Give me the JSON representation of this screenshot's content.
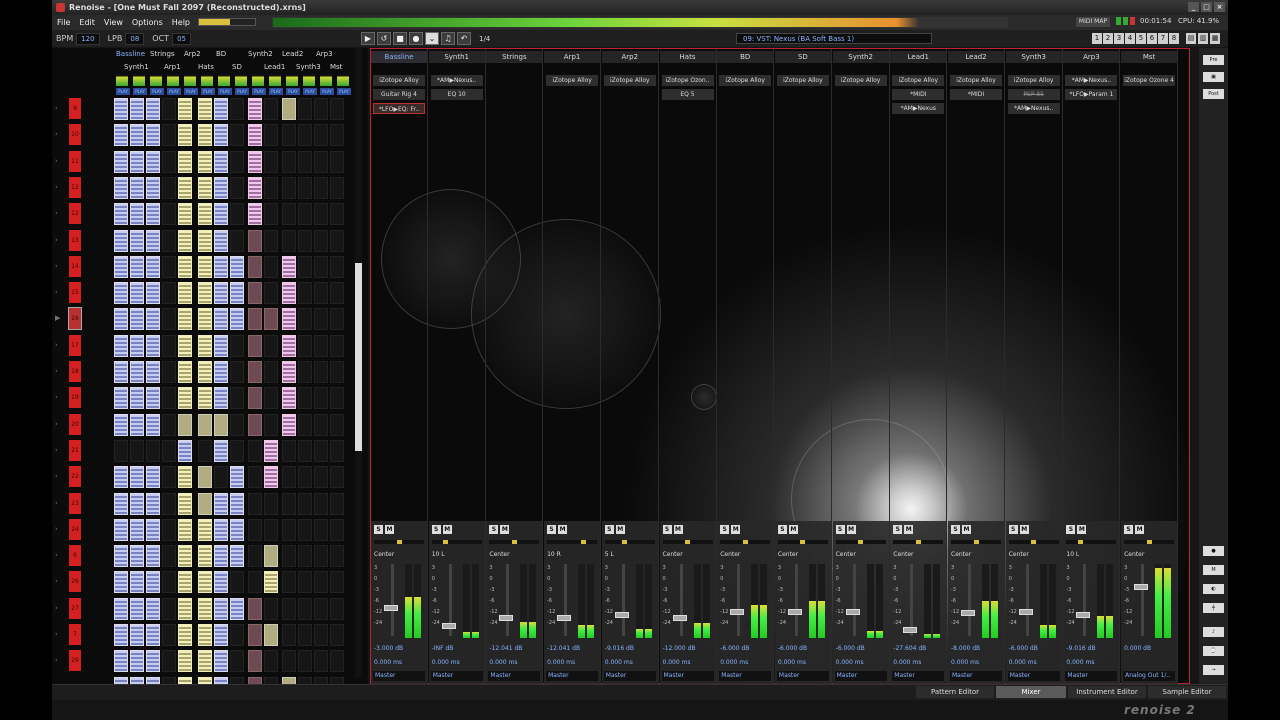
{
  "window": {
    "title": "Renoise - [One Must Fall 2097 (Reconstructed).xrns]"
  },
  "menu": [
    "File",
    "Edit",
    "View",
    "Options",
    "Help"
  ],
  "status": {
    "midi_map": "MIDI MAP",
    "time": "00:01:54",
    "cpu": "CPU: 41.9%"
  },
  "toolbar": {
    "bpm_label": "BPM",
    "bpm": "120",
    "lpb_label": "LPB",
    "lpb": "08",
    "oct_label": "OCT",
    "oct": "05",
    "line_spacing": "1/4"
  },
  "instrument": {
    "selected": "09: VST: Nexus (BA Soft Bass 1)"
  },
  "track_numbers": [
    "1",
    "2",
    "3",
    "4",
    "5",
    "6",
    "7",
    "8"
  ],
  "pattern_matrix": {
    "headers_top": [
      "Bassline",
      "Strings",
      "Arp2",
      "BD",
      "Synth2",
      "Lead2",
      "Arp3"
    ],
    "headers_bottom": [
      "Synth1",
      "Arp1",
      "Hats",
      "SD",
      "Lead1",
      "Synth3",
      "Mst"
    ],
    "play_label": "PLAY",
    "sequence": [
      "9",
      "10",
      "11",
      "12",
      "12",
      "13",
      "14",
      "15",
      "16",
      "17",
      "18",
      "19",
      "20",
      "21",
      "22",
      "23",
      "24",
      "6",
      "26",
      "27",
      "7",
      "29"
    ]
  },
  "mixer": {
    "tracks": [
      {
        "name": "Bassline",
        "fx": [
          "iZotope Alloy",
          "Guitar Rig 4",
          "*LFO▶EQ: Fr.."
        ],
        "pan": "Center",
        "vol": "-3.000 dB",
        "delay": "0.000 ms",
        "route": "Master"
      },
      {
        "name": "Synth1",
        "fx": [
          "*AM▶Nexus..",
          "EQ 10"
        ],
        "pan": "10 L",
        "vol": "-INF dB",
        "delay": "0.000 ms",
        "route": "Master"
      },
      {
        "name": "Strings",
        "fx": [],
        "pan": "Center",
        "vol": "-12.041 dB",
        "delay": "0.000 ms",
        "route": "Master"
      },
      {
        "name": "Arp1",
        "fx": [
          "iZotope Alloy"
        ],
        "pan": "10 R",
        "vol": "-12.041 dB",
        "delay": "0.000 ms",
        "route": "Master"
      },
      {
        "name": "Arp2",
        "fx": [
          "iZotope Alloy"
        ],
        "pan": "5 L",
        "vol": "-9.016 dB",
        "delay": "0.000 ms",
        "route": "Master"
      },
      {
        "name": "Hats",
        "fx": [
          "iZotope Ozon..",
          "EQ 5"
        ],
        "pan": "Center",
        "vol": "-12.000 dB",
        "delay": "0.000 ms",
        "route": "Master"
      },
      {
        "name": "BD",
        "fx": [
          "iZotope Alloy"
        ],
        "pan": "Center",
        "vol": "-6.000 dB",
        "delay": "0.000 ms",
        "route": "Master"
      },
      {
        "name": "SD",
        "fx": [
          "iZotope Alloy"
        ],
        "pan": "Center",
        "vol": "-6.000 dB",
        "delay": "0.000 ms",
        "route": "Master"
      },
      {
        "name": "Synth2",
        "fx": [
          "iZotope Alloy"
        ],
        "pan": "Center",
        "vol": "-6.000 dB",
        "delay": "0.000 ms",
        "route": "Master"
      },
      {
        "name": "Lead1",
        "fx": [
          "iZotope Alloy",
          "*MIDI",
          "*AM▶Nexus"
        ],
        "pan": "Center",
        "vol": "-27.604 dB",
        "delay": "0.000 ms",
        "route": "Master"
      },
      {
        "name": "Lead2",
        "fx": [
          "iZotope Alloy",
          "*MIDI"
        ],
        "pan": "Center",
        "vol": "-8.000 dB",
        "delay": "0.000 ms",
        "route": "Master"
      },
      {
        "name": "Synth3",
        "fx": [
          "iZotope Alloy",
          "PSP 85",
          "*AM▶Nexus.."
        ],
        "pan": "Center",
        "vol": "-6.000 dB",
        "delay": "0.000 ms",
        "route": "Master"
      },
      {
        "name": "Arp3",
        "fx": [
          "*AM▶Nexus..",
          "*LFO▶Param 1"
        ],
        "pan": "10 L",
        "vol": "-9.016 dB",
        "delay": "0.000 ms",
        "route": "Master"
      },
      {
        "name": "Mst",
        "fx": [
          "iZotope Ozone 4"
        ],
        "pan": "Center",
        "vol": "0.000 dB",
        "delay": "",
        "route": "Analog Out 1/.."
      }
    ],
    "scale": [
      "3",
      "0",
      "-3",
      "-6",
      "-12",
      "-24"
    ]
  },
  "right_panel": {
    "pre": "Pre",
    "post": "Post"
  },
  "tabs": [
    "Pattern Editor",
    "Mixer",
    "Instrument Editor",
    "Sample Editor"
  ],
  "logo": "renoise 2",
  "colors": {
    "accent": "#8ab4ff",
    "seq_red": "#d42020",
    "active_border": "#b23"
  }
}
